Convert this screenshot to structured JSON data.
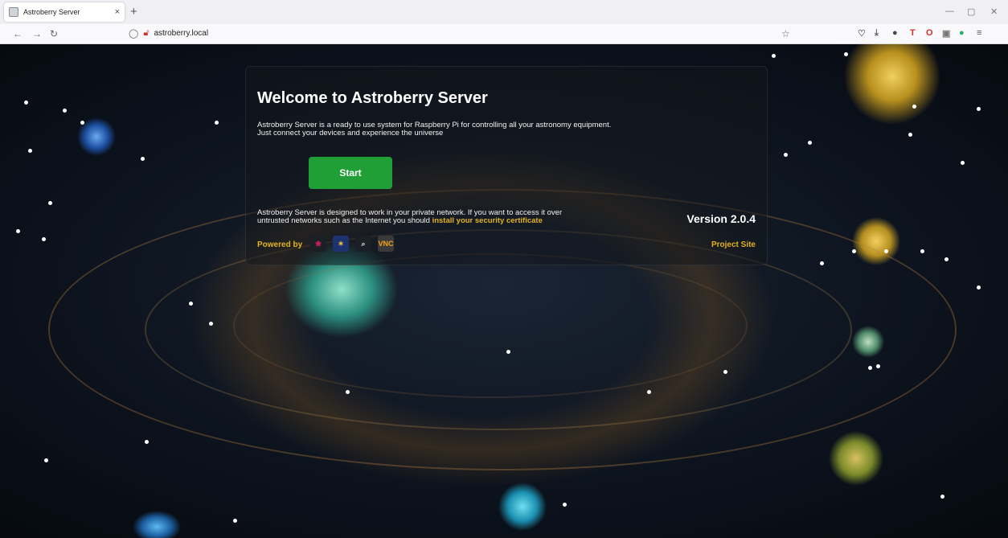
{
  "browser": {
    "tab_title": "Astroberry Server",
    "tab_close": "×",
    "new_tab": "+",
    "url": "astroberry.local",
    "window_controls": [
      "—",
      "▢",
      "✕"
    ],
    "extensions": [
      {
        "name": "pocket-icon",
        "glyph": "♡",
        "color": "#666666"
      },
      {
        "name": "download-icon",
        "glyph": "⤓",
        "color": "#666666"
      },
      {
        "name": "extension-circle-icon",
        "glyph": "●",
        "color": "#444444"
      },
      {
        "name": "text-t-icon",
        "glyph": "T",
        "color": "#d0302b"
      },
      {
        "name": "opera-o-icon",
        "glyph": "O",
        "color": "#d0302b"
      },
      {
        "name": "image-icon",
        "glyph": "▣",
        "color": "#777777"
      },
      {
        "name": "green-extension-icon",
        "glyph": "●",
        "color": "#27ae60"
      },
      {
        "name": "menu-icon",
        "glyph": "≡",
        "color": "#555555"
      }
    ]
  },
  "panel": {
    "title": "Welcome to Astroberry Server",
    "intro_line1": "Astroberry Server is a ready to use system for Raspberry Pi for controlling all your astronomy equipment.",
    "intro_line2": "Just connect your devices and experience the universe",
    "start_label": "Start",
    "note_line1": "Astroberry Server is designed to work in your private network. If you want to access it over",
    "note_line2": "untrusted networks such as the Internet you should ",
    "cert_link": "install your security certificate",
    "version": "Version 2.0.4",
    "powered_by": "Powered by",
    "project_site": "Project Site",
    "logos": [
      {
        "name": "raspberry-pi-logo-icon",
        "glyph": "❀",
        "bg": "#1b1f26",
        "color": "#d0205a"
      },
      {
        "name": "indi-logo-icon",
        "glyph": "✶",
        "bg": "#1d3270",
        "color": "#f4c430"
      },
      {
        "name": "telescope-logo-icon",
        "glyph": "⌕",
        "bg": "#1b1f26",
        "color": "#dddddd"
      },
      {
        "name": "vnc-logo-icon",
        "glyph": "VNC",
        "bg": "#3a3a3a",
        "color": "#f3a21a"
      }
    ]
  }
}
